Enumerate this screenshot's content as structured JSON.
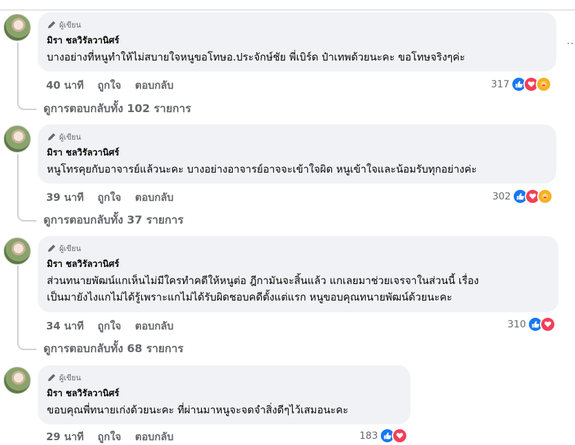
{
  "author_badge": "ผู้เขียน",
  "comments": [
    {
      "author": "มิรา ชลวิรัลวานิศร์",
      "lines": [
        "บางอย่างที่หนูทำให้ไม่สบายใจหนูขอโทษอ.ประจักษ์ชัย พี่เบิร์ด ป๋าเทพด้วยนะคะ ขอโทษจริงๆค่ะ"
      ],
      "time": "40 นาที",
      "like": "ถูกใจ",
      "reply": "ตอบกลับ",
      "reaction_count": "317",
      "reactions": [
        "like",
        "love",
        "care"
      ],
      "view_replies": "ดูการตอบกลับทั้ง 102 รายการ"
    },
    {
      "author": "มิรา ชลวิรัลวานิศร์",
      "lines": [
        "หนูโทรคุยกับอาจารย์แล้วนะคะ บางอย่างอาจารย์อาจจะเข้าใจผิด หนูเข้าใจและน้อมรับทุกอย่างค่ะ"
      ],
      "time": "39 นาที",
      "like": "ถูกใจ",
      "reply": "ตอบกลับ",
      "reaction_count": "302",
      "reactions": [
        "like",
        "love",
        "care"
      ],
      "view_replies": "ดูการตอบกลับทั้ง 37 รายการ"
    },
    {
      "author": "มิรา ชลวิรัลวานิศร์",
      "lines": [
        "ส่วนทนายพัฒน์แกเห็นไม่มีใครทำคดีให้หนูต่อ ฎีกามันจะสิ้นแล้ว แกเลยมาช่วยเจรจาในส่วนนี้ เรื่อง",
        "เป็นมายังไงแกไม่ได้รู้เพราะแกไม่ได้รับผิดชอบคดีตั้งแต่แรก หนูขอบคุณทนายพัฒน์ด้วยนะคะ"
      ],
      "time": "34 นาที",
      "like": "ถูกใจ",
      "reply": "ตอบกลับ",
      "reaction_count": "310",
      "reactions": [
        "like",
        "love"
      ],
      "view_replies": "ดูการตอบกลับทั้ง 68 รายการ"
    },
    {
      "author": "มิรา ชลวิรัลวานิศร์",
      "lines": [
        "ขอบคุณพี่ทนายเก่งด้วยนะคะ ที่ผ่านมาหนูจะจดจำสิ่งดีๆไว้เสมอนะคะ"
      ],
      "time": "29 นาที",
      "like": "ถูกใจ",
      "reply": "ตอบกลับ",
      "reaction_count": "183",
      "reactions": [
        "like",
        "love"
      ]
    }
  ],
  "more_label": "..."
}
